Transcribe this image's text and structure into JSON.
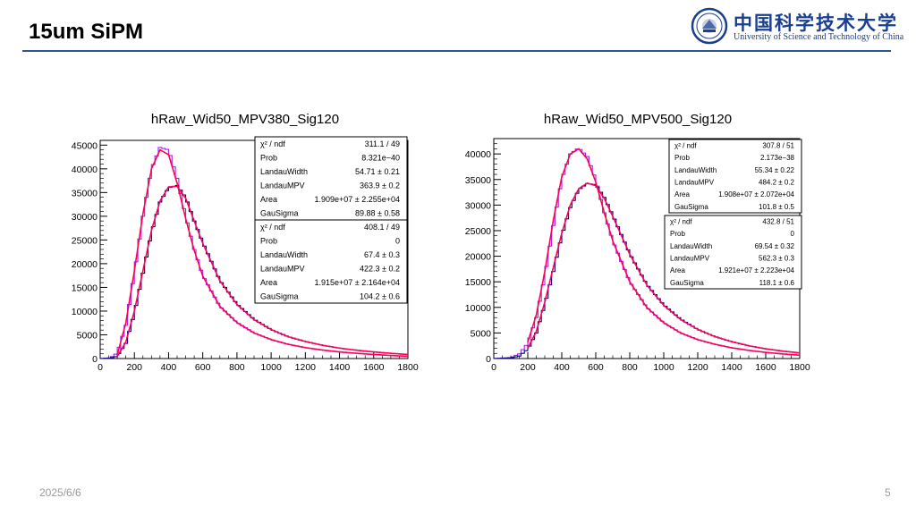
{
  "slide": {
    "title": "15um SiPM",
    "date": "2025/6/6",
    "page": "5",
    "logo_cn": "中国科学技术大学",
    "logo_en": "University of Science and Technology of China"
  },
  "chart_data": [
    {
      "type": "line",
      "title": "hRaw_Wid50_MPV380_Sig120",
      "xlim": [
        0,
        1800
      ],
      "ylim": [
        0,
        46000
      ],
      "xticks": [
        "0",
        "200",
        "400",
        "600",
        "800",
        "1000",
        "1200",
        "1400",
        "1600",
        "1800"
      ],
      "yticks": [
        "0",
        "5000",
        "10000",
        "15000",
        "20000",
        "25000",
        "30000",
        "35000",
        "40000",
        "45000"
      ],
      "series": [
        {
          "color": "#a020f0",
          "x": [
            0,
            60,
            100,
            150,
            200,
            250,
            300,
            350,
            400,
            450,
            500,
            550,
            600,
            700,
            800,
            900,
            1000,
            1100,
            1200,
            1300,
            1400,
            1500,
            1600,
            1700,
            1800
          ],
          "y": [
            0,
            150,
            1200,
            7000,
            18000,
            30000,
            40000,
            44500,
            44000,
            38000,
            30000,
            23000,
            17500,
            11000,
            7600,
            5400,
            4000,
            3000,
            2300,
            1800,
            1400,
            1100,
            850,
            650,
            450
          ]
        },
        {
          "color": "#000080",
          "x": [
            0,
            60,
            100,
            150,
            200,
            250,
            300,
            350,
            400,
            450,
            500,
            550,
            600,
            700,
            800,
            900,
            1000,
            1100,
            1200,
            1300,
            1400,
            1500,
            1600,
            1700,
            1800
          ],
          "y": [
            0,
            80,
            500,
            3200,
            9500,
            18000,
            26500,
            33000,
            36000,
            36500,
            34000,
            29000,
            24500,
            16500,
            11500,
            8300,
            6100,
            4600,
            3600,
            2800,
            2200,
            1750,
            1400,
            1100,
            850
          ]
        }
      ],
      "fits": [
        {
          "color": "#ff0055",
          "x": [
            100,
            150,
            200,
            250,
            300,
            350,
            400,
            450,
            500,
            550,
            600,
            700,
            800,
            900,
            1000,
            1100,
            1200,
            1300,
            1400,
            1500,
            1600,
            1700,
            1800
          ],
          "y": [
            800,
            7500,
            18500,
            30500,
            40000,
            44000,
            43000,
            37000,
            29500,
            22800,
            17400,
            11000,
            7600,
            5400,
            4000,
            3000,
            2300,
            1800,
            1400,
            1100,
            850,
            650,
            450
          ]
        },
        {
          "color": "#ff0055",
          "x": [
            100,
            150,
            200,
            250,
            300,
            350,
            400,
            450,
            500,
            550,
            600,
            700,
            800,
            900,
            1000,
            1100,
            1200,
            1300,
            1400,
            1500,
            1600,
            1700,
            1800
          ],
          "y": [
            400,
            3500,
            10000,
            18500,
            27000,
            33200,
            36200,
            36300,
            33800,
            29000,
            24300,
            16400,
            11400,
            8200,
            6100,
            4600,
            3600,
            2800,
            2200,
            1750,
            1400,
            1100,
            850
          ]
        }
      ],
      "stat_boxes": [
        {
          "rows": [
            {
              "label": "χ² / ndf",
              "value": "311.1 / 49"
            },
            {
              "label": "Prob",
              "value": "8.321e−40"
            },
            {
              "label": "LandauWidth",
              "value": "54.71 ± 0.21"
            },
            {
              "label": "LandauMPV",
              "value": "363.9 ± 0.2"
            },
            {
              "label": "Area",
              "value": "1.909e+07 ± 2.255e+04"
            },
            {
              "label": "GauSigma",
              "value": "89.88 ± 0.58"
            }
          ]
        },
        {
          "rows": [
            {
              "label": "χ² / ndf",
              "value": "408.1 / 49"
            },
            {
              "label": "Prob",
              "value": "0"
            },
            {
              "label": "LandauWidth",
              "value": "67.4 ± 0.3"
            },
            {
              "label": "LandauMPV",
              "value": "422.3 ± 0.2"
            },
            {
              "label": "Area",
              "value": "1.915e+07 ± 2.164e+04"
            },
            {
              "label": "GauSigma",
              "value": "104.2 ± 0.6"
            }
          ]
        }
      ]
    },
    {
      "type": "line",
      "title": "hRaw_Wid50_MPV500_Sig120",
      "xlim": [
        0,
        1800
      ],
      "ylim": [
        0,
        43000
      ],
      "xticks": [
        "0",
        "200",
        "400",
        "600",
        "800",
        "1000",
        "1200",
        "1400",
        "1600",
        "1800"
      ],
      "yticks": [
        "0",
        "5000",
        "10000",
        "15000",
        "20000",
        "25000",
        "30000",
        "35000",
        "40000"
      ],
      "series": [
        {
          "color": "#a020f0",
          "x": [
            0,
            100,
            150,
            200,
            250,
            300,
            350,
            400,
            450,
            500,
            550,
            600,
            650,
            700,
            800,
            900,
            1000,
            1100,
            1200,
            1300,
            1400,
            1500,
            1600,
            1700,
            1800
          ],
          "y": [
            0,
            200,
            900,
            3000,
            8000,
            16000,
            26000,
            35000,
            40000,
            41200,
            39500,
            35000,
            28500,
            23000,
            15000,
            10000,
            7000,
            5000,
            3700,
            2800,
            2100,
            1600,
            1200,
            900,
            650
          ]
        },
        {
          "color": "#000080",
          "x": [
            0,
            100,
            150,
            200,
            250,
            300,
            350,
            400,
            450,
            500,
            550,
            600,
            650,
            700,
            800,
            900,
            1000,
            1100,
            1200,
            1300,
            1400,
            1500,
            1600,
            1700,
            1800
          ],
          "y": [
            0,
            100,
            500,
            1800,
            5000,
            10500,
            17000,
            24000,
            29500,
            33000,
            34200,
            34000,
            31500,
            28000,
            20500,
            14500,
            10500,
            7700,
            5700,
            4300,
            3300,
            2500,
            1900,
            1450,
            1100
          ]
        }
      ],
      "fits": [
        {
          "color": "#ff0055",
          "x": [
            200,
            250,
            300,
            350,
            400,
            450,
            500,
            550,
            600,
            650,
            700,
            800,
            900,
            1000,
            1100,
            1200,
            1300,
            1400,
            1500,
            1600,
            1700,
            1800
          ],
          "y": [
            3200,
            8500,
            17000,
            27000,
            35500,
            40000,
            41000,
            39000,
            34500,
            28500,
            23000,
            15000,
            10000,
            7000,
            5000,
            3700,
            2800,
            2100,
            1600,
            1200,
            900,
            650
          ]
        },
        {
          "color": "#ff0055",
          "x": [
            200,
            250,
            300,
            350,
            400,
            450,
            500,
            550,
            600,
            650,
            700,
            800,
            900,
            1000,
            1100,
            1200,
            1300,
            1400,
            1500,
            1600,
            1700,
            1800
          ],
          "y": [
            2000,
            5300,
            11000,
            17800,
            24500,
            30000,
            33200,
            34300,
            33800,
            31300,
            27800,
            20400,
            14400,
            10400,
            7600,
            5700,
            4300,
            3300,
            2500,
            1900,
            1450,
            1100
          ]
        }
      ],
      "stat_boxes": [
        {
          "rows": [
            {
              "label": "χ² / ndf",
              "value": "307.8 / 51"
            },
            {
              "label": "Prob",
              "value": "2.173e−38"
            },
            {
              "label": "LandauWidth",
              "value": "55.34 ± 0.22"
            },
            {
              "label": "LandauMPV",
              "value": "484.2 ± 0.2"
            },
            {
              "label": "Area",
              "value": "1.908e+07 ± 2.072e+04"
            },
            {
              "label": "GauSigma",
              "value": "101.8 ± 0.5"
            }
          ]
        },
        {
          "rows": [
            {
              "label": "χ² / ndf",
              "value": "432.8 / 51"
            },
            {
              "label": "Prob",
              "value": "0"
            },
            {
              "label": "LandauWidth",
              "value": "69.54 ± 0.32"
            },
            {
              "label": "LandauMPV",
              "value": "562.3 ± 0.3"
            },
            {
              "label": "Area",
              "value": "1.921e+07 ± 2.223e+04"
            },
            {
              "label": "GauSigma",
              "value": "118.1 ± 0.6"
            }
          ]
        }
      ]
    }
  ]
}
